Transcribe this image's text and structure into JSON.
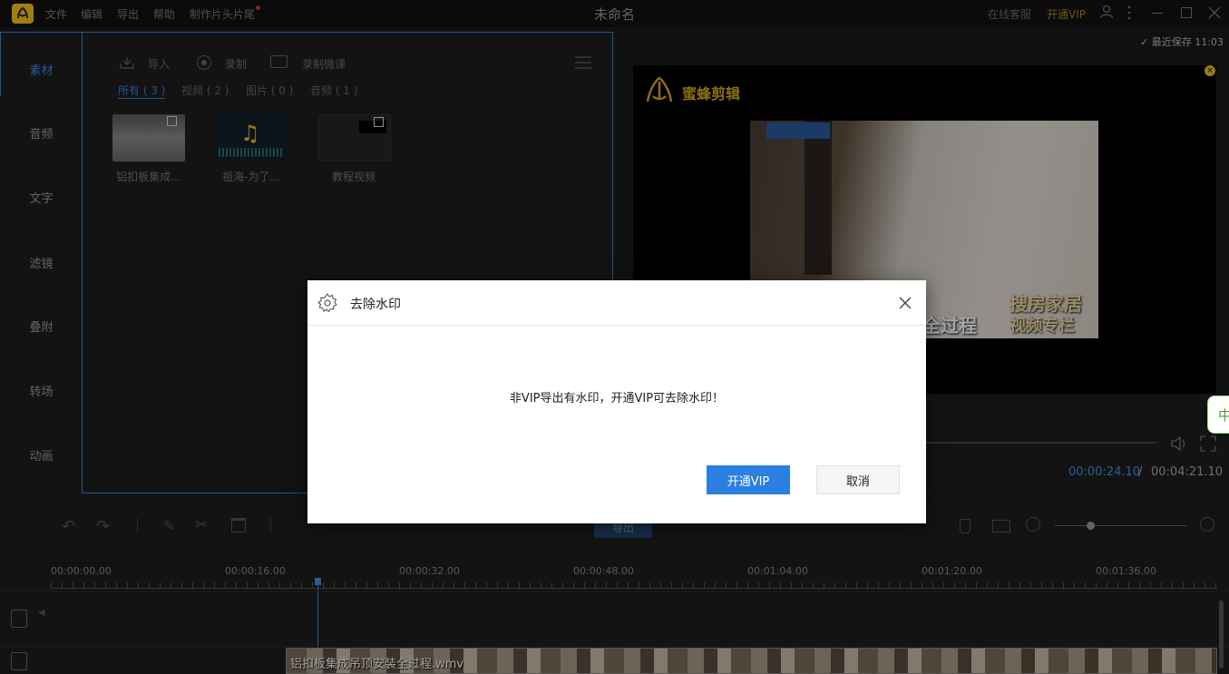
{
  "window": {
    "title": "未命名",
    "menu": [
      "文件",
      "编辑",
      "导出",
      "帮助",
      "制作片头片尾"
    ],
    "feedback": "在线客服",
    "vip": "开通VIP"
  },
  "sidebar": {
    "items": [
      "素材",
      "音频",
      "文字",
      "滤镜",
      "叠附",
      "转场",
      "动画"
    ]
  },
  "media": {
    "toolbar": {
      "import": "导入",
      "record": "录制",
      "record_screen": "录制微课"
    },
    "filter_tabs": [
      "所有 ( 3 )",
      "视频 ( 2 )",
      "图片 ( 0 )",
      "音频 ( 1 )"
    ],
    "items": [
      "铝扣板集成...",
      "祖海-为了...",
      "教程视频"
    ]
  },
  "preview": {
    "last_saved": "最近保存 11:03",
    "brand": "蜜蜂剪辑",
    "overlay_text_1": "搜房家居",
    "overlay_text_2": "全过程",
    "overlay_text_3": "视频专栏",
    "current_time": "00:00:24.10",
    "separator": "/",
    "total_time": "00:04:21.10"
  },
  "timeline": {
    "export_button": "导出",
    "ruler": [
      "00:00:00.00",
      "00:00:16.00",
      "00:00:32.00",
      "00:00:48.00",
      "00:01:04.00",
      "00:01:20.00",
      "00:01:36.00"
    ],
    "clip_name": "铝扣板集成吊顶安装全过程.wmv"
  },
  "dialog": {
    "title": "去除水印",
    "message": "非VIP导出有水印，开通VIP可去除水印！",
    "confirm": "开通VIP",
    "cancel": "取消"
  },
  "side_tab": "中",
  "colors": {
    "accent": "#2a7fe0",
    "vip_gold": "#e0b420",
    "time_blue": "#4a90e2"
  }
}
